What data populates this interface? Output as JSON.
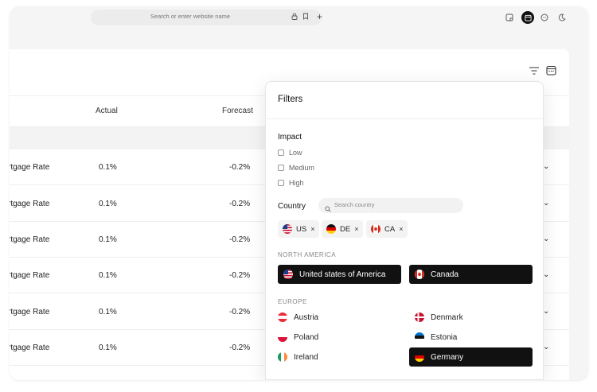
{
  "browser": {
    "url_placeholder": "Search or enter website name",
    "icons": [
      "lock-icon",
      "bookmark-icon",
      "plus-icon",
      "notes-icon",
      "calendar-icon",
      "chat-icon",
      "moon-icon"
    ]
  },
  "table": {
    "columns": {
      "actual": "Actual",
      "forecast": "Forecast"
    },
    "rows": [
      {
        "event": "rtgage Rate",
        "actual": "0.1%",
        "forecast": "-0.2%"
      },
      {
        "event": "rtgage Rate",
        "actual": "0.1%",
        "forecast": "-0.2%"
      },
      {
        "event": "rtgage Rate",
        "actual": "0.1%",
        "forecast": "-0.2%"
      },
      {
        "event": "rtgage Rate",
        "actual": "0.1%",
        "forecast": "-0.2%"
      },
      {
        "event": "rtgage Rate",
        "actual": "0.1%",
        "forecast": "-0.2%"
      },
      {
        "event": "rtgage Rate",
        "actual": "0.1%",
        "forecast": "-0.2%"
      }
    ]
  },
  "filters": {
    "title": "Filters",
    "impact": {
      "label": "Impact",
      "options": [
        "Low",
        "Medium",
        "High"
      ]
    },
    "country": {
      "label": "Country",
      "search_placeholder": "Search country",
      "chips": [
        "US",
        "DE",
        "CA"
      ]
    },
    "regions": [
      {
        "name": "NORTH AMERICA",
        "countries": [
          {
            "name": "United states of America",
            "selected": true
          },
          {
            "name": "Canada",
            "selected": true
          }
        ]
      },
      {
        "name": "EUROPE",
        "countries": [
          {
            "name": "Austria",
            "selected": false
          },
          {
            "name": "Denmark",
            "selected": false
          },
          {
            "name": "Poland",
            "selected": false
          },
          {
            "name": "Estonia",
            "selected": false
          },
          {
            "name": "Ireland",
            "selected": false
          },
          {
            "name": "Germany",
            "selected": true
          }
        ]
      }
    ]
  },
  "colors": {
    "selected_bg": "#111111",
    "page_bg": "#f5f5f5"
  }
}
